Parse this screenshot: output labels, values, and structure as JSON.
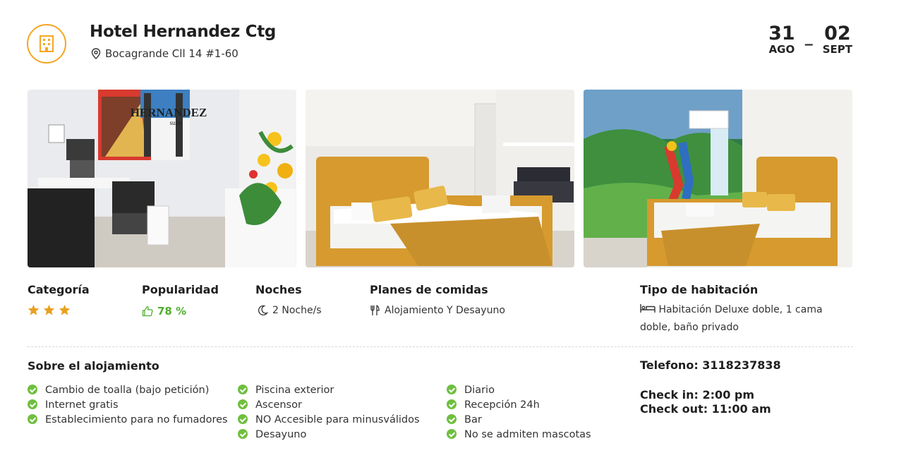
{
  "hotel": {
    "name": "Hotel Hernandez Ctg",
    "address": "Bocagrande Cll 14 #1-60",
    "icon": "hotel-building-icon"
  },
  "dates": {
    "checkin_day": "31",
    "checkin_month": "AGO",
    "separator": "_",
    "checkout_day": "02",
    "checkout_month": "SEPT"
  },
  "photos": {
    "sign_text": "HERNANDEZ",
    "sign_sub": "suite"
  },
  "info": {
    "category_label": "Categoría",
    "category_stars": 3,
    "popularity_label": "Popularidad",
    "popularity_value": "78 %",
    "nights_label": "Noches",
    "nights_value": "2 Noche/s",
    "meal_label": "Planes de comidas",
    "meal_value": "Alojamiento Y Desayuno",
    "room_label": "Tipo de habitación",
    "room_value": "Habitación Deluxe doble, 1 cama doble, baño privado"
  },
  "about": {
    "title": "Sobre el alojamiento",
    "columns": [
      [
        "Cambio de toalla (bajo petición)",
        "Internet gratis",
        "Establecimiento para no fumadores"
      ],
      [
        "Piscina exterior",
        "Ascensor",
        "NO Accesible para minusválidos",
        "Desayuno"
      ],
      [
        "Diario",
        "Recepción 24h",
        "Bar",
        "No se admiten mascotas"
      ]
    ]
  },
  "contact": {
    "phone": "Telefono: 3118237838",
    "checkin": "Check in: 2:00 pm",
    "checkout": "Check out: 11:00 am"
  },
  "colors": {
    "accent": "#f5a623",
    "star": "#e8a020",
    "popularity": "#4caf2a",
    "check": "#6fbf3f"
  }
}
